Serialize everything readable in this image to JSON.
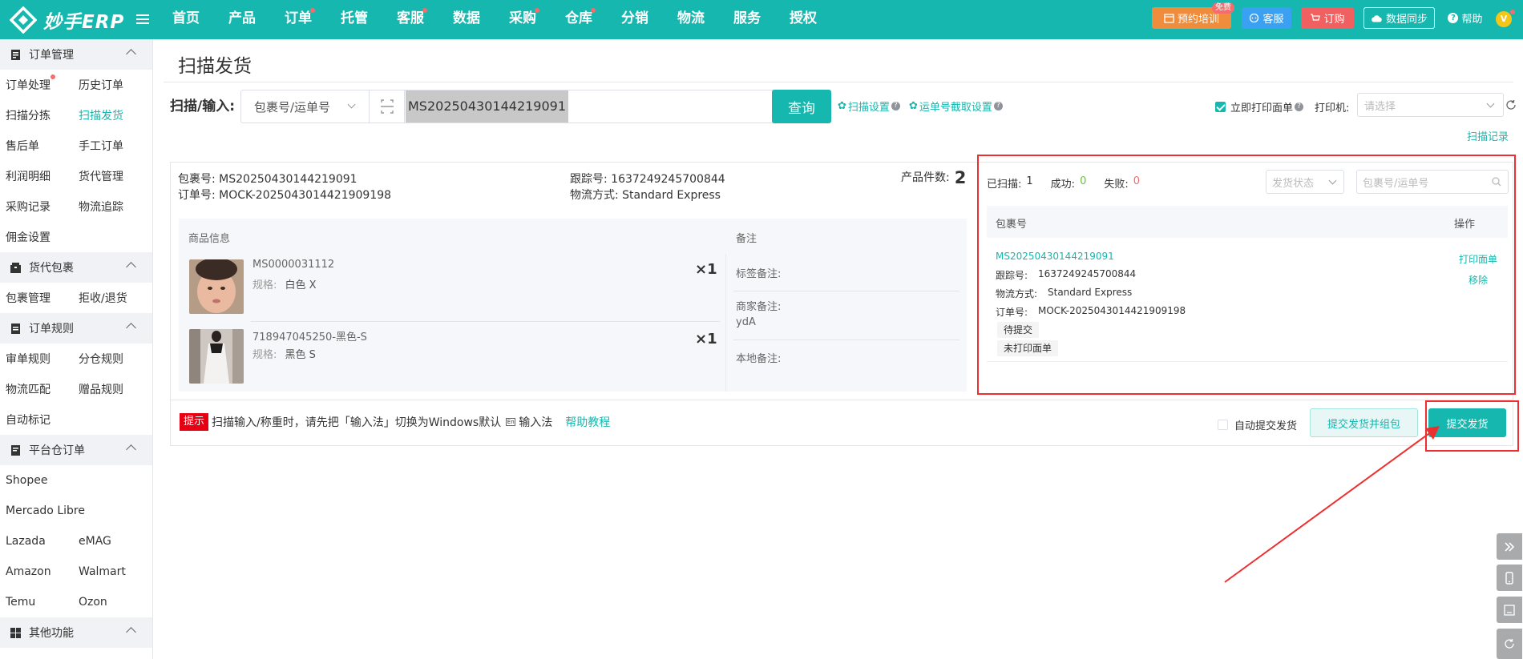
{
  "app": {
    "logo_text": "妙手ERP"
  },
  "nav": [
    {
      "label": "首页",
      "dot": false
    },
    {
      "label": "产品",
      "dot": false
    },
    {
      "label": "订单",
      "dot": true
    },
    {
      "label": "托管",
      "dot": false
    },
    {
      "label": "客服",
      "dot": true
    },
    {
      "label": "数据",
      "dot": false
    },
    {
      "label": "采购",
      "dot": true
    },
    {
      "label": "仓库",
      "dot": true
    },
    {
      "label": "分销",
      "dot": false
    },
    {
      "label": "物流",
      "dot": false
    },
    {
      "label": "服务",
      "dot": false
    },
    {
      "label": "授权",
      "dot": false
    }
  ],
  "topbar": {
    "training": "预约培训",
    "free_badge": "免费",
    "service": "客服",
    "subscribe": "订购",
    "sync": "数据同步",
    "help": "帮助",
    "user_initial": "V"
  },
  "sidebar": {
    "sections": [
      {
        "title": "订单管理",
        "items": [
          [
            "订单处理",
            "历史订单"
          ],
          [
            "扫描分拣",
            "扫描发货"
          ],
          [
            "售后单",
            "手工订单"
          ],
          [
            "利润明细",
            "货代管理"
          ],
          [
            "采购记录",
            "物流追踪"
          ],
          [
            "佣金设置"
          ]
        ]
      },
      {
        "title": "货代包裹",
        "items": [
          [
            "包裹管理",
            "拒收/退货"
          ]
        ]
      },
      {
        "title": "订单规则",
        "items": [
          [
            "审单规则",
            "分仓规则"
          ],
          [
            "物流匹配",
            "赠品规则"
          ],
          [
            "自动标记"
          ]
        ]
      },
      {
        "title": "平台仓订单",
        "items": [
          [
            "Shopee"
          ],
          [
            "Mercado Libre"
          ],
          [
            "Lazada",
            "eMAG"
          ],
          [
            "Amazon",
            "Walmart"
          ],
          [
            "Temu",
            "Ozon"
          ]
        ]
      },
      {
        "title": "其他功能",
        "items": []
      }
    ],
    "active": "扫描发货",
    "dot_item": "订单处理"
  },
  "page": {
    "title": "扫描发货",
    "scan_label": "扫描/输入:",
    "scan_type": "包裹号/运单号",
    "scan_value": "MS20250430144219091",
    "query": "查询",
    "scan_settings": "扫描设置",
    "waybill_settings": "运单号截取设置",
    "print_now": "立即打印面单",
    "printer_label": "打印机:",
    "printer_placeholder": "请选择",
    "scan_records": "扫描记录"
  },
  "package": {
    "pkg_label": "包裹号:",
    "pkg_no": "MS20250430144219091",
    "order_label": "订单号:",
    "order_no": "MOCK-2025043014421909198",
    "track_label": "跟踪号:",
    "track_no": "1637249245700844",
    "ship_label": "物流方式:",
    "ship_method": "Standard Express",
    "qty_label": "产品件数:",
    "qty": "2",
    "col_goods": "商品信息",
    "col_note": "备注",
    "items": [
      {
        "sku": "MS0000031112",
        "spec_label": "规格:",
        "spec": "白色 X",
        "qty": "×1"
      },
      {
        "sku": "718947045250-黑色-S",
        "spec_label": "规格:",
        "spec": "黑色 S",
        "qty": "×1"
      }
    ],
    "notes": {
      "tag_note": "标签备注:",
      "seller_note": "商家备注:",
      "seller_note_value": "ydA",
      "local_note": "本地备注:"
    }
  },
  "results": {
    "scanned_label": "已扫描:",
    "scanned": "1",
    "success_label": "成功:",
    "success": "0",
    "fail_label": "失败:",
    "fail": "0",
    "status_placeholder": "发货状态",
    "search_placeholder": "包裹号/运单号",
    "col_pkg": "包裹号",
    "col_action": "操作",
    "row": {
      "pkg_no": "MS20250430144219091",
      "track_label": "跟踪号:",
      "track_no": "1637249245700844",
      "ship_label": "物流方式:",
      "ship_method": "Standard Express",
      "order_label": "订单号:",
      "order_no": "MOCK-2025043014421909198",
      "tag1": "待提交",
      "tag2": "未打印面单",
      "print": "打印面单",
      "remove": "移除"
    }
  },
  "bottom": {
    "hint_tag": "提示",
    "hint_text": "扫描输入/称重时，请先把「输入法」切换为Windows默认",
    "ime": "输入法",
    "tutorial": "帮助教程",
    "auto_submit": "自动提交发货",
    "submit_pack": "提交发货并组包",
    "submit": "提交发货"
  },
  "colors": {
    "brand": "#15b7ae",
    "red": "#ed2f2f",
    "dot": "#f56c6c",
    "success": "#67c23a",
    "fail": "#f56c6c"
  }
}
